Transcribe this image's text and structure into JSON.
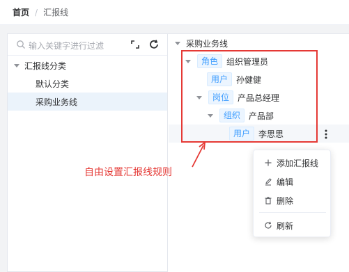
{
  "breadcrumb": {
    "home": "首页",
    "separator": "/",
    "current": "汇报线"
  },
  "left": {
    "search_placeholder": "输入关键字进行过滤",
    "tree": [
      {
        "label": "汇报线分类",
        "expanded": true
      },
      {
        "label": "默认分类"
      },
      {
        "label": "采购业务线",
        "selected": true
      }
    ]
  },
  "right": {
    "root_label": "采购业务线",
    "nodes": [
      {
        "tag": "角色",
        "label": "组织管理员"
      },
      {
        "tag": "用户",
        "label": "孙健健"
      },
      {
        "tag": "岗位",
        "label": "产品总经理"
      },
      {
        "tag": "组织",
        "label": "产品部"
      },
      {
        "tag": "用户",
        "label": "李思思"
      }
    ]
  },
  "annotation": "自由设置汇报线规则",
  "context_menu": {
    "items": [
      {
        "label": "添加汇报线",
        "icon": "plus-icon"
      },
      {
        "label": "编辑",
        "icon": "edit-icon"
      },
      {
        "label": "删除",
        "icon": "trash-icon"
      },
      {
        "label": "刷新",
        "icon": "refresh-icon"
      }
    ]
  },
  "colors": {
    "tag_blue": "#409eff",
    "annotation_red": "#e53935",
    "selected_bg": "#ebf3fb"
  }
}
